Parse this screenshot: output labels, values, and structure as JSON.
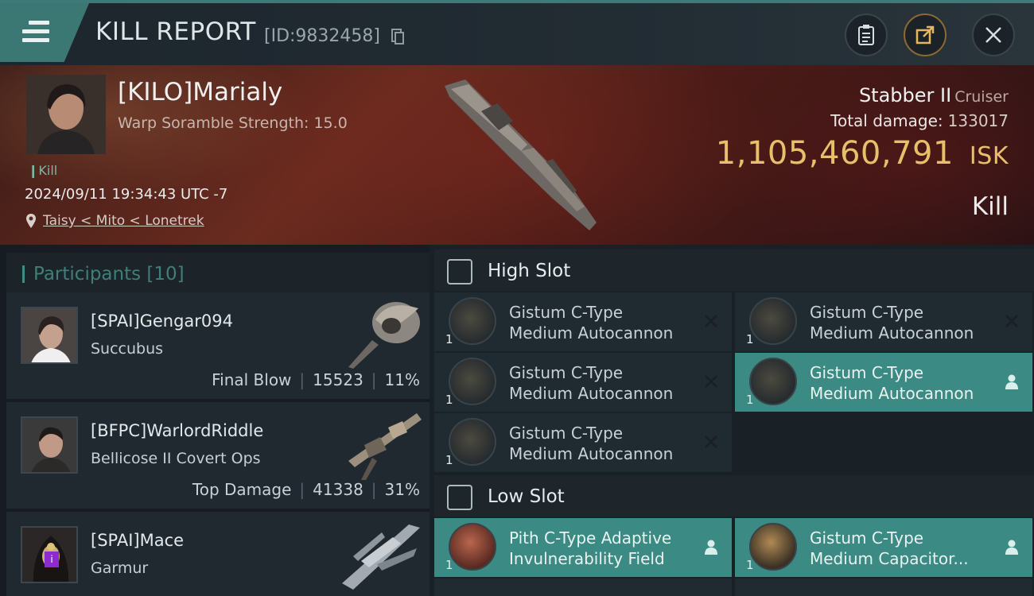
{
  "header": {
    "title": "KILL REPORT",
    "report_id": "[ID:9832458]",
    "icons": [
      "menu-icon",
      "copy-icon",
      "clipboard-icon",
      "share-icon",
      "close-icon"
    ]
  },
  "victim": {
    "name": "[KILO]Marialy",
    "scramble": "Warp Soramble Strength: 15.0",
    "tag": "Kill",
    "timestamp": "2024/09/11 19:34:43 UTC -7",
    "location": "Taisy < Mito < Lonetrek",
    "ship": "Stabber II",
    "ship_class": "Cruiser",
    "damage_label": "Total damage:",
    "damage_value": "133017",
    "isk_value": "1,105,460,791",
    "isk_unit": "ISK",
    "result": "Kill"
  },
  "participants": {
    "label": "Participants",
    "count": "[10]",
    "items": [
      {
        "name": "[SPAI]Gengar094",
        "ship": "Succubus",
        "role": "Final Blow",
        "damage": "15523",
        "percent": "11%"
      },
      {
        "name": "[BFPC]WarlordRiddle",
        "ship": "Bellicose II Covert Ops",
        "role": "Top Damage",
        "damage": "41338",
        "percent": "31%"
      },
      {
        "name": "[SPAI]Mace",
        "ship": "Garmur",
        "role": "",
        "damage": "",
        "percent": ""
      }
    ]
  },
  "fitting": {
    "high_slot_label": "High Slot",
    "low_slot_label": "Low Slot",
    "high_modules": [
      {
        "line1": "Gistum C-Type",
        "line2": "Medium Autocannon",
        "qty": "1",
        "state": "destroyed"
      },
      {
        "line1": "Gistum C-Type",
        "line2": "Medium Autocannon",
        "qty": "1",
        "state": "destroyed"
      },
      {
        "line1": "Gistum C-Type",
        "line2": "Medium Autocannon",
        "qty": "1",
        "state": "destroyed"
      },
      {
        "line1": "Gistum C-Type",
        "line2": "Medium Autocannon",
        "qty": "1",
        "state": "dropped"
      },
      {
        "line1": "Gistum C-Type",
        "line2": "Medium Autocannon",
        "qty": "1",
        "state": "destroyed"
      }
    ],
    "low_modules": [
      {
        "line1": "Pith C-Type Adaptive",
        "line2": "Invulnerability Field",
        "qty": "1",
        "state": "dropped"
      },
      {
        "line1": "Gistum C-Type",
        "line2": "Medium Capacitor...",
        "qty": "1",
        "state": "dropped"
      }
    ]
  },
  "colors": {
    "accent": "#3b8a83",
    "isk": "#e8c06a",
    "banner": "#6b2b1f"
  }
}
